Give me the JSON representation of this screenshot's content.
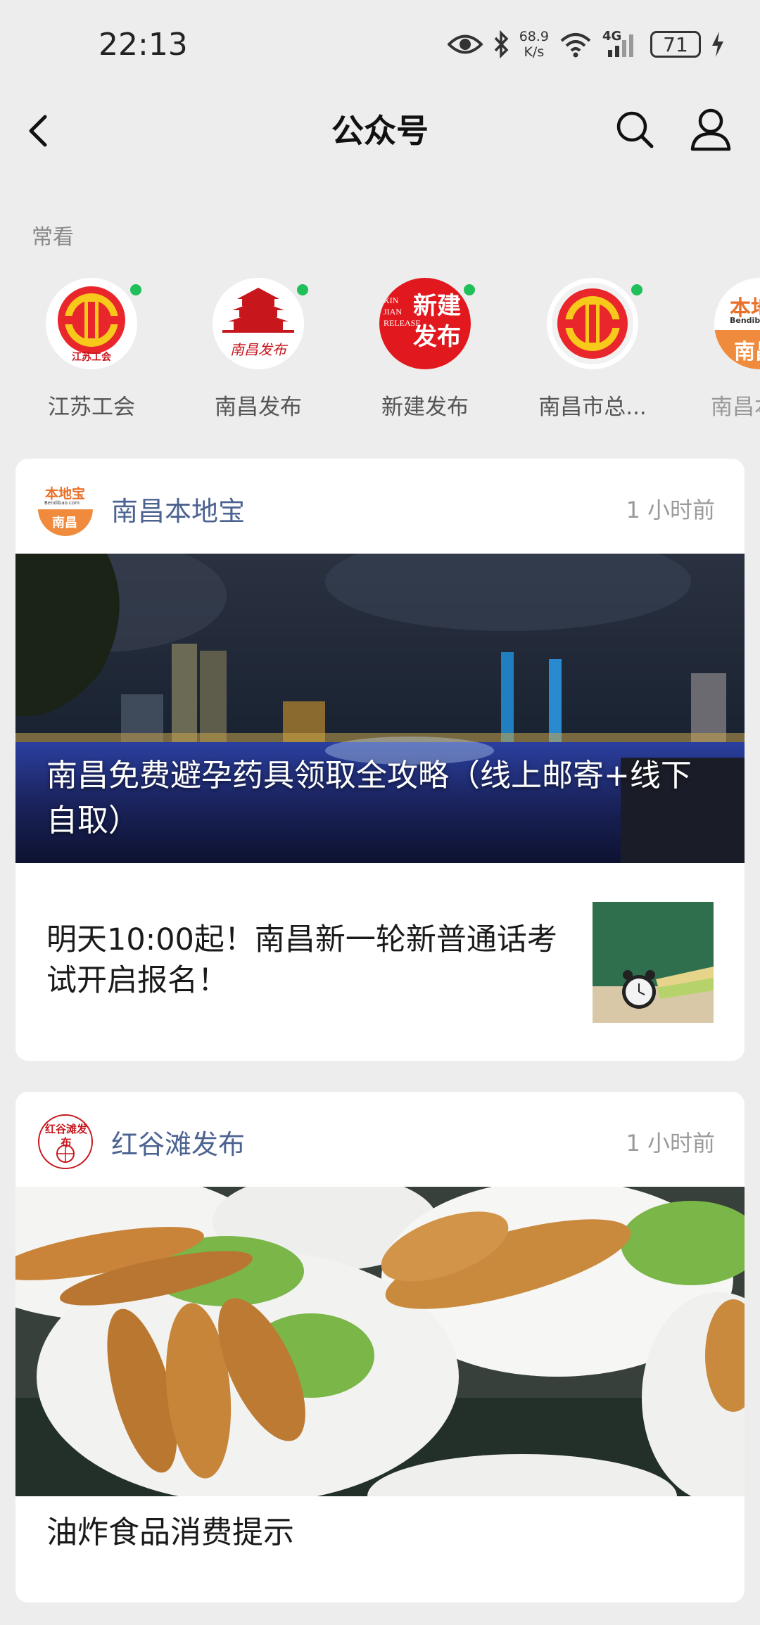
{
  "status_bar": {
    "time": "22:13",
    "net_speed_value": "68.9",
    "net_speed_unit": "K/s",
    "network": "4G",
    "battery": "71"
  },
  "nav": {
    "title": "公众号"
  },
  "frequent": {
    "label": "常看",
    "accounts": [
      {
        "name": "江苏工会",
        "has_update": true
      },
      {
        "name": "南昌发布",
        "has_update": true
      },
      {
        "name": "新建发布",
        "has_update": true
      },
      {
        "name": "南昌市总...",
        "has_update": true
      },
      {
        "name": "南昌本"
      }
    ],
    "logo_texts": {
      "jiangsu_union": "江苏工会",
      "nanchang_release": "南昌发布",
      "xinjian_release": "新建发布",
      "xinjian_latin": "XIN JIAN RELEASE",
      "bendibao_top": "本地宝",
      "bendibao_sub": "Bendibao.com",
      "bendibao_city": "南昌"
    }
  },
  "cards": [
    {
      "source": "南昌本地宝",
      "time": "1 小时前",
      "cover_title": "南昌免费避孕药具领取全攻略（线上邮寄+线下自取）",
      "article_title": "明天10:00起！南昌新一轮新普通话考试开启报名！"
    },
    {
      "source": "红谷滩发布",
      "time": "1 小时前",
      "logo_text": "红谷滩发布",
      "article_title": "油炸食品消费提示"
    }
  ],
  "colors": {
    "update_dot": "#1fbf5a",
    "source_name": "#4c6391",
    "background": "#ededed"
  }
}
